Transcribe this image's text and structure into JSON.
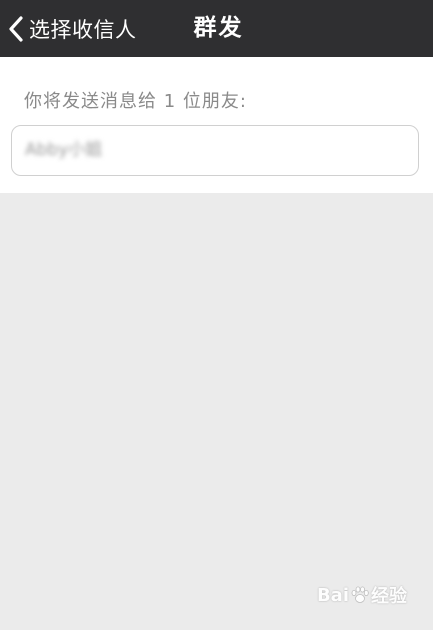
{
  "nav": {
    "back_label": "选择收信人",
    "title": "群发"
  },
  "recipients": {
    "hint": "你将发送消息给 1 位朋友:",
    "count": 1,
    "items": [
      {
        "name": "Abby小姐"
      }
    ]
  },
  "watermark": {
    "brand_left": "Bai",
    "brand_right": "经验"
  },
  "colors": {
    "nav_background": "#2f2f31",
    "page_background": "#ebebeb",
    "card_background": "#ffffff",
    "hint_text": "#8a8a8a"
  },
  "icons": {
    "back": "chevron-left-icon",
    "watermark_paw": "paw-icon"
  }
}
